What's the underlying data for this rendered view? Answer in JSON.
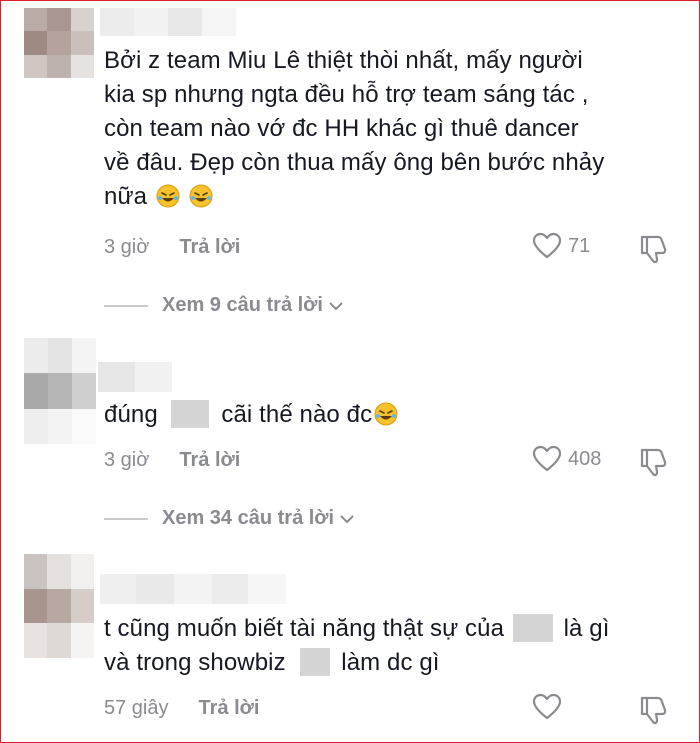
{
  "comments": [
    {
      "lines": [
        "Bởi z team Miu Lê thiệt thòi nhất, mấy người",
        "kia sp nhưng ngta đều hỗ trợ team sáng tác ,",
        "còn team nào vớ đc HH khác gì thuê dancer",
        "về đâu. Đẹp còn thua mấy ông bên bước nhảy",
        "nữa"
      ],
      "time": "3 giờ",
      "reply_label": "Trả lời",
      "likes": "71",
      "view_replies": "Xem 9 câu trả lời"
    },
    {
      "text_before": "đúng",
      "text_after": "cãi thế nào đc",
      "time": "3 giờ",
      "reply_label": "Trả lời",
      "likes": "408",
      "view_replies": "Xem 34 câu trả lời"
    },
    {
      "line1_before": "t cũng muốn biết tài năng thật sự của",
      "line1_after": "là gì",
      "line2_before": "và trong showbiz",
      "line2_after": "làm dc gì",
      "time": "57 giây",
      "reply_label": "Trả lời",
      "likes": ""
    }
  ],
  "icons": {
    "like": "heart-outline-icon",
    "dislike": "thumbs-down-icon",
    "laugh": "rolling-on-floor-laughing-emoji",
    "chevron": "chevron-down-icon"
  },
  "colors": {
    "frame": "#d8202a",
    "text": "#161823",
    "muted": "#8a8b91"
  }
}
